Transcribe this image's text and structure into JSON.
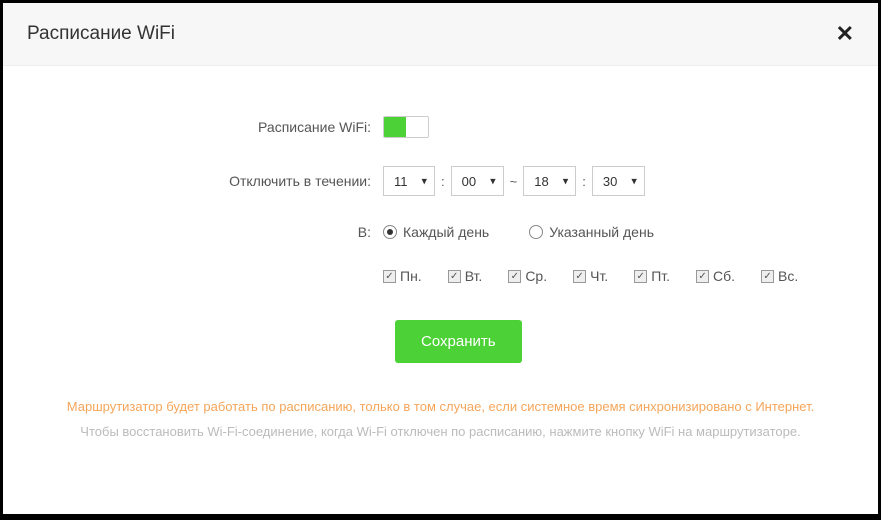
{
  "header": {
    "title": "Расписание WiFi"
  },
  "form": {
    "schedule_label": "Расписание WiFi:",
    "schedule_enabled": true,
    "disable_during_label": "Отключить в течении:",
    "time": {
      "start_hour": "11",
      "start_min": "00",
      "end_hour": "18",
      "end_min": "30"
    },
    "days_in_label": "В:",
    "mode": {
      "every_day": "Каждый день",
      "specific_day": "Указанный день",
      "selected": "every_day"
    },
    "days": [
      {
        "label": "Пн.",
        "checked": true
      },
      {
        "label": "Вт.",
        "checked": true
      },
      {
        "label": "Ср.",
        "checked": true
      },
      {
        "label": "Чт.",
        "checked": true
      },
      {
        "label": "Пт.",
        "checked": true
      },
      {
        "label": "Сб.",
        "checked": true
      },
      {
        "label": "Вс.",
        "checked": true
      }
    ],
    "save_label": "Сохранить"
  },
  "notes": {
    "warning": "Маршрутизатор будет работать по расписанию, только в том случае, если системное время синхронизировано с Интернет.",
    "hint": "Чтобы восстановить Wi-Fi-соединение, когда Wi-Fi отключен по расписанию, нажмите кнопку WiFi на маршрутизаторе."
  }
}
